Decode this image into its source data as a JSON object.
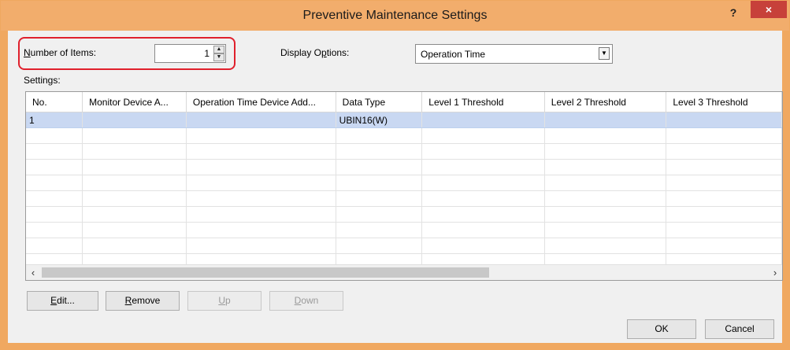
{
  "window": {
    "title": "Preventive Maintenance Settings",
    "help_glyph": "?",
    "close_glyph": "×"
  },
  "number_of_items": {
    "label_underlined": "N",
    "label_rest": "umber of Items:",
    "value": "1"
  },
  "display_options": {
    "label_before": "Display O",
    "label_underlined": "p",
    "label_after": "tions:",
    "selected": "Operation Time"
  },
  "settings": {
    "label": "Settings:",
    "columns": [
      "No.",
      "Monitor Device A...",
      "Operation Time Device Add...",
      "Data Type",
      "Level 1 Threshold",
      "Level 2 Threshold",
      "Level 3 Threshold"
    ],
    "rows": [
      [
        "1",
        "",
        "",
        "UBIN16(W)",
        "",
        "",
        ""
      ],
      [
        "",
        "",
        "",
        "",
        "",
        "",
        ""
      ],
      [
        "",
        "",
        "",
        "",
        "",
        "",
        ""
      ],
      [
        "",
        "",
        "",
        "",
        "",
        "",
        ""
      ],
      [
        "",
        "",
        "",
        "",
        "",
        "",
        ""
      ],
      [
        "",
        "",
        "",
        "",
        "",
        "",
        ""
      ],
      [
        "",
        "",
        "",
        "",
        "",
        "",
        ""
      ],
      [
        "",
        "",
        "",
        "",
        "",
        "",
        ""
      ],
      [
        "",
        "",
        "",
        "",
        "",
        "",
        ""
      ],
      [
        "",
        "",
        "",
        "",
        "",
        "",
        ""
      ]
    ],
    "selected_row": 0
  },
  "buttons": {
    "edit": {
      "u": "E",
      "rest": "dit..."
    },
    "remove": {
      "u": "R",
      "rest": "emove"
    },
    "up": {
      "u": "U",
      "rest": "p"
    },
    "down": {
      "u": "D",
      "rest": "own"
    },
    "ok": "OK",
    "cancel": "Cancel"
  },
  "colors": {
    "titlebar": "#f2ad6c",
    "close_button": "#c7413a",
    "selected_row": "#c9d8f2",
    "highlight_box": "#e0202c"
  }
}
